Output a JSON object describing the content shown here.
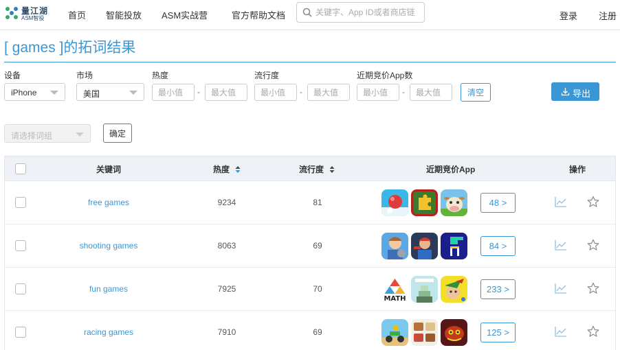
{
  "header": {
    "logo_main": "量江湖",
    "logo_sub": "ASM智投",
    "nav": [
      "首页",
      "智能投放",
      "ASM实战营",
      "官方帮助文档"
    ],
    "search_placeholder": "关键字、App ID或者商店链",
    "login": "登录",
    "register": "注册"
  },
  "page": {
    "title": "[ games ]的拓词结果"
  },
  "filters": {
    "device_label": "设备",
    "device_value": "iPhone",
    "market_label": "市场",
    "market_value": "美国",
    "heat_label": "热度",
    "flow_label": "流行度",
    "apps_label": "近期竞价App数",
    "min_placeholder": "最小值",
    "max_placeholder": "最大值",
    "dash": "-",
    "clear_label": "清空",
    "export_label": "导出",
    "group_placeholder": "请选择词组",
    "confirm_label": "确定"
  },
  "table": {
    "headers": {
      "keyword": "关键词",
      "heat": "热度",
      "flow": "流行度",
      "apps": "近期竞价App",
      "actions": "操作"
    },
    "rows": [
      {
        "keyword": "free games",
        "heat": "9234",
        "flow": "81",
        "count": "48 >",
        "apps": [
          "red-ball-app-icon",
          "jigsaw-puzzle-app-icon",
          "farm-cow-app-icon"
        ]
      },
      {
        "keyword": "shooting games",
        "heat": "8063",
        "flow": "69",
        "count": "84 >",
        "apps": [
          "homescapes-app-icon",
          "shooter-hero-app-icon",
          "blocks-app-icon"
        ]
      },
      {
        "keyword": "fun games",
        "heat": "7925",
        "flow": "70",
        "count": "233 >",
        "apps": [
          "math-app-icon",
          "stack-tower-app-icon",
          "robin-hood-app-icon"
        ]
      },
      {
        "keyword": "racing games",
        "heat": "7910",
        "flow": "69",
        "count": "125 >",
        "apps": [
          "moto-racing-app-icon",
          "food-app-icon",
          "dragon-app-icon"
        ]
      }
    ]
  },
  "colors": {
    "accent": "#3a97d4",
    "header_bg": "#eef2f6"
  }
}
